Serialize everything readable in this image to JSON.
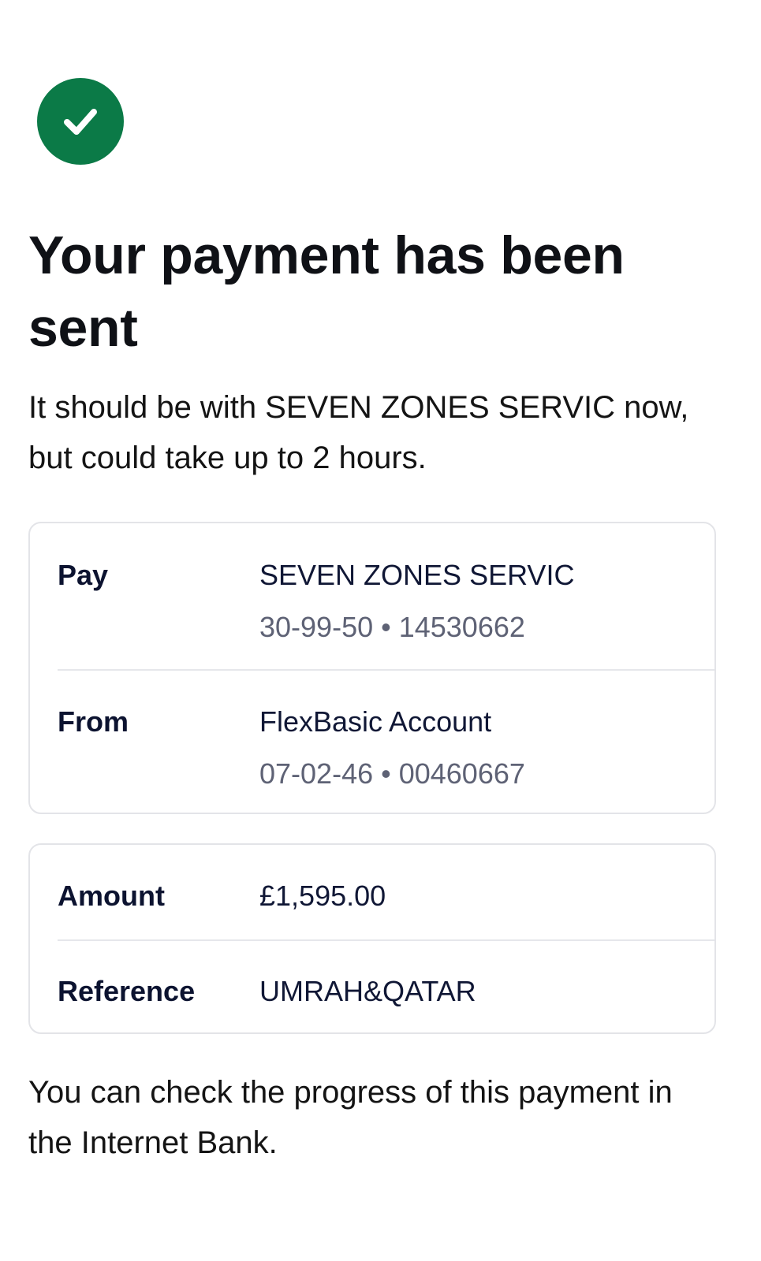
{
  "icons": {
    "success": "check-circle-icon",
    "success_color": "#0b7a47"
  },
  "header": {
    "title": "Your payment has been sent",
    "subtitle": "It should be with SEVEN ZONES SERVIC now, but could take up to 2 hours."
  },
  "details_card": {
    "pay": {
      "label": "Pay",
      "name": "SEVEN ZONES SERVIC",
      "account": "30-99-50 • 14530662"
    },
    "from": {
      "label": "From",
      "name": "FlexBasic Account",
      "account": "07-02-46 • 00460667"
    }
  },
  "amount_card": {
    "amount": {
      "label": "Amount",
      "value": "£1,595.00"
    },
    "reference": {
      "label": "Reference",
      "value": "UMRAH&QATAR"
    }
  },
  "footer": {
    "note": "You can check the progress of this payment in the Internet Bank."
  }
}
